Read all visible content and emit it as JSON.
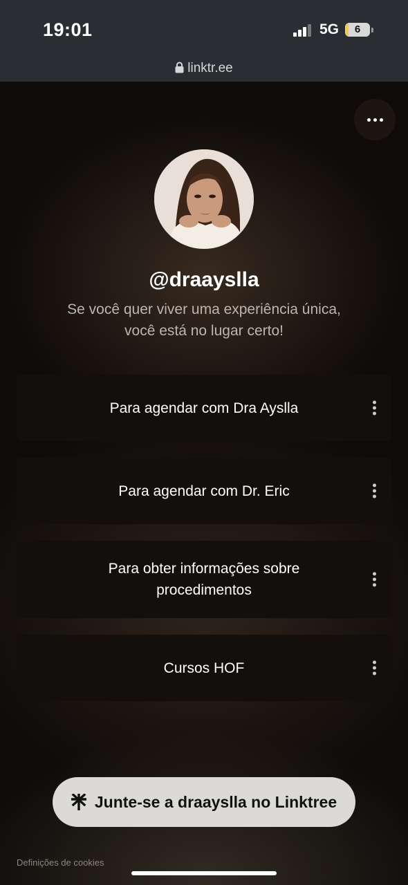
{
  "status_bar": {
    "time": "19:01",
    "network": "5G",
    "battery": "6"
  },
  "browser": {
    "url": "linktr.ee"
  },
  "profile": {
    "username": "@draayslla",
    "bio": "Se você quer viver uma experiência única, você está no lugar certo!"
  },
  "links": [
    {
      "label": "Para agendar com Dra Ayslla"
    },
    {
      "label": "Para agendar com Dr. Eric"
    },
    {
      "label": "Para obter informações sobre procedimentos"
    },
    {
      "label": "Cursos HOF"
    }
  ],
  "footer": {
    "join_label": "Junte-se a draayslla no Linktree",
    "cookies_label": "Definições de cookies"
  },
  "colors": {
    "background": "#0e0b09",
    "card": "#120f0d",
    "join_button": "#dcdad6",
    "status_bar": "#2a2d31"
  }
}
